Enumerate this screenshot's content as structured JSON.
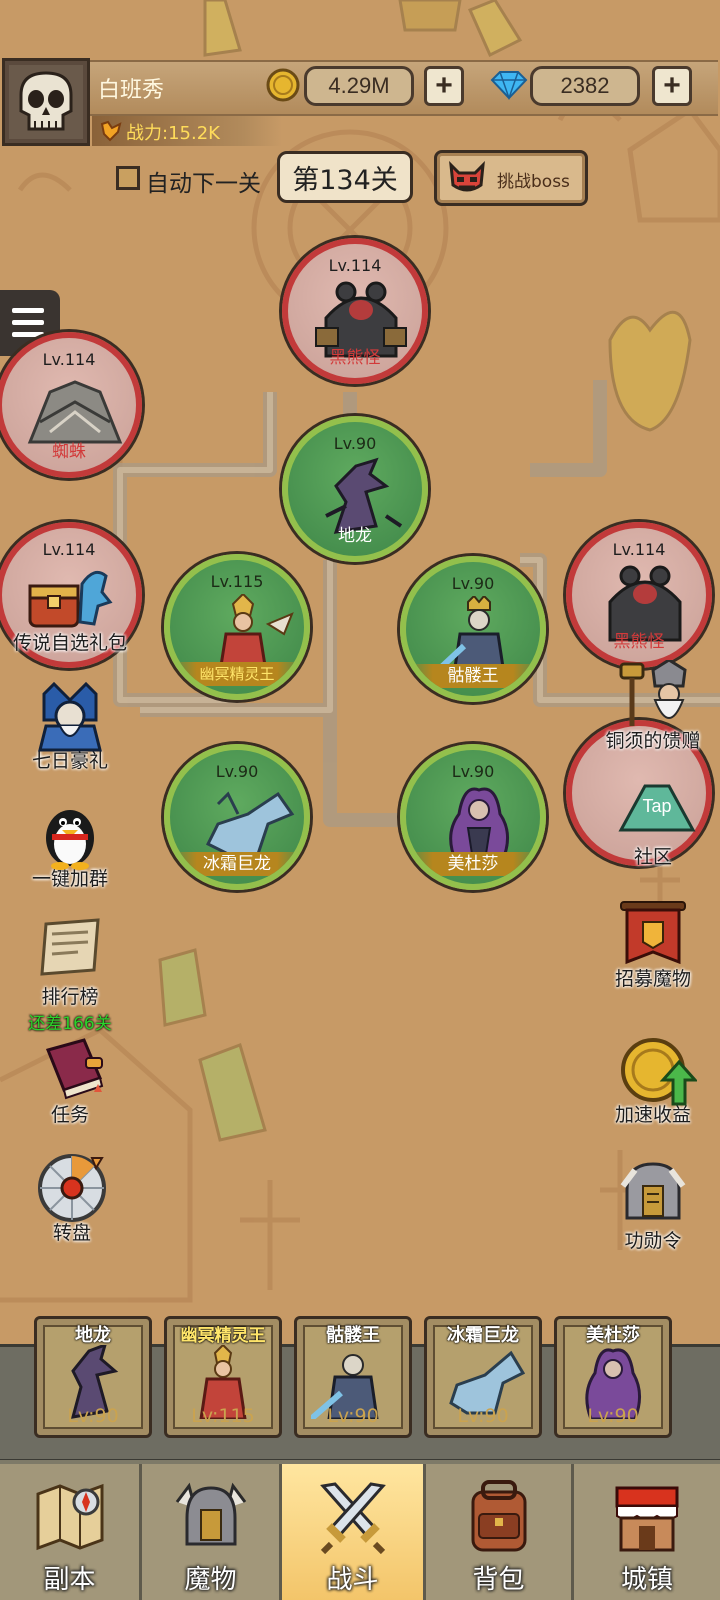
{
  "player": {
    "name": "白班秀",
    "power": "战力:15.2K",
    "gold": "4.29M",
    "gems": "2382",
    "plus": "+"
  },
  "controls": {
    "auto_next": "自动下一关",
    "level": "第134关",
    "boss_button": "挑战boss"
  },
  "nodes": [
    {
      "lv": "Lv.114",
      "name": "黑熊怪",
      "state": "enemy"
    },
    {
      "lv": "Lv.114",
      "name": "蜘蛛",
      "state": "enemy"
    },
    {
      "lv": "Lv.90",
      "name": "地龙",
      "state": "owned"
    },
    {
      "lv": "Lv.114",
      "name": "",
      "state": "enemy"
    },
    {
      "lv": "Lv.115",
      "name": "幽冥精灵王",
      "state": "owned"
    },
    {
      "lv": "Lv.90",
      "name": "骷髅王",
      "state": "owned"
    },
    {
      "lv": "Lv.114",
      "name": "黑熊怪",
      "state": "enemy"
    },
    {
      "lv": "Lv.90",
      "name": "冰霜巨龙",
      "state": "owned"
    },
    {
      "lv": "Lv.90",
      "name": "美杜莎",
      "state": "owned"
    },
    {
      "lv": "",
      "name": "",
      "state": "enemy"
    }
  ],
  "left_menu": [
    {
      "label": "传说自选礼包",
      "icon": "chest-dragon-icon"
    },
    {
      "label": "七日豪礼",
      "icon": "knight-helmet-icon"
    },
    {
      "label": "一键加群",
      "icon": "penguin-icon"
    },
    {
      "label": "排行榜",
      "sub": "还差166关",
      "icon": "scroll-icon"
    },
    {
      "label": "任务",
      "icon": "quest-book-icon"
    },
    {
      "label": "转盘",
      "icon": "wheel-icon"
    }
  ],
  "right_menu": [
    {
      "label": "铜须的馈赠",
      "icon": "dwarf-hammer-icon"
    },
    {
      "label": "社区",
      "icon": "tap-community-icon",
      "tap": "Tap"
    },
    {
      "label": "招募魔物",
      "icon": "banner-icon"
    },
    {
      "label": "加速收益",
      "icon": "coin-arrow-icon"
    },
    {
      "label": "功勋令",
      "icon": "helmet-medal-icon"
    }
  ],
  "team": [
    {
      "name": "地龙",
      "lv": "Lv:90"
    },
    {
      "name": "幽冥精灵王",
      "lv": "Lv:115"
    },
    {
      "name": "骷髅王",
      "lv": "Lv:90"
    },
    {
      "name": "冰霜巨龙",
      "lv": "Lv:90"
    },
    {
      "name": "美杜莎",
      "lv": "Lv:90"
    }
  ],
  "nav": [
    {
      "label": "副本",
      "active": false
    },
    {
      "label": "魔物",
      "active": false
    },
    {
      "label": "战斗",
      "active": true
    },
    {
      "label": "背包",
      "active": false
    },
    {
      "label": "城镇",
      "active": false
    }
  ]
}
